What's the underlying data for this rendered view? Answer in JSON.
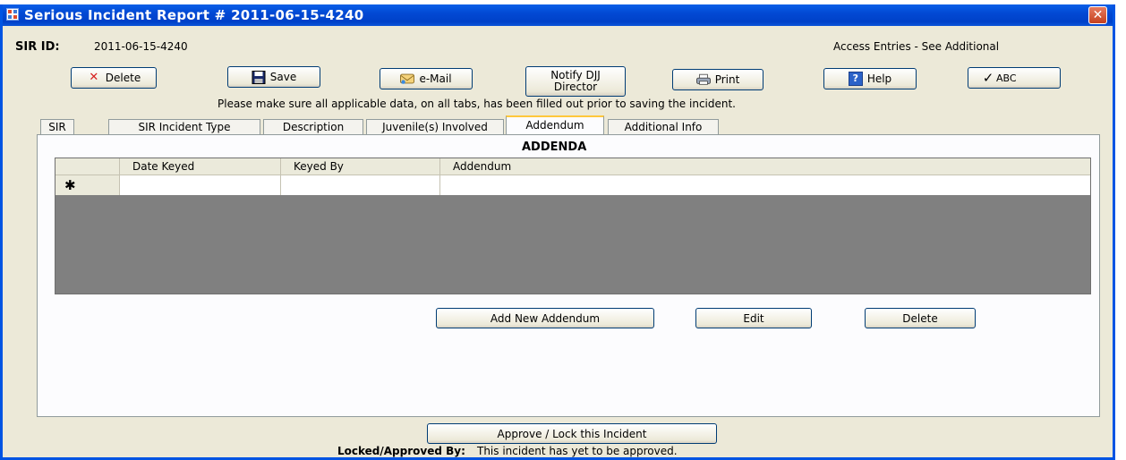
{
  "window": {
    "title": "Serious Incident Report # 2011-06-15-4240",
    "close_symbol": "✕"
  },
  "sir": {
    "id_label": "SIR ID:",
    "id_value": "2011-06-15-4240",
    "access_text": "Access Entries - See Additional"
  },
  "toolbar": {
    "delete": "Delete",
    "save": "Save",
    "email": "e-Mail",
    "notify_line1": "Notify DJJ",
    "notify_line2": "Director",
    "print": "Print",
    "help": "Help",
    "spell": "ABC"
  },
  "notice": "Please make sure all applicable data, on all tabs, has been filled out prior to saving the incident.",
  "tabs": [
    {
      "label": "SIR"
    },
    {
      "label": "SIR Incident Type"
    },
    {
      "label": "Description"
    },
    {
      "label": "Juvenile(s) Involved"
    },
    {
      "label": "Addendum",
      "active": true
    },
    {
      "label": "Additional Info"
    }
  ],
  "addenda": {
    "heading": "ADDENDA",
    "columns": [
      "Date Keyed",
      "Keyed By",
      "Addendum"
    ],
    "new_row_marker": "✱",
    "rows": []
  },
  "actions": {
    "add": "Add New Addendum",
    "edit": "Edit",
    "delete": "Delete"
  },
  "footer": {
    "approve": "Approve / Lock this Incident",
    "locked_label": "Locked/Approved By:",
    "locked_value": "This incident has yet to be approved."
  },
  "icons": {
    "app": "form-icon",
    "delete": "red-x-icon",
    "save": "floppy-disk-icon",
    "email": "envelope-icon",
    "print": "printer-icon",
    "help": "question-mark-icon",
    "spell": "checkmark-icon"
  },
  "colors": {
    "titlebar": "#0054e3",
    "window_face": "#ece9d8",
    "grid_empty": "#808080",
    "tab_highlight": "#ffc83c",
    "delete_icon": "#d61f1f"
  }
}
